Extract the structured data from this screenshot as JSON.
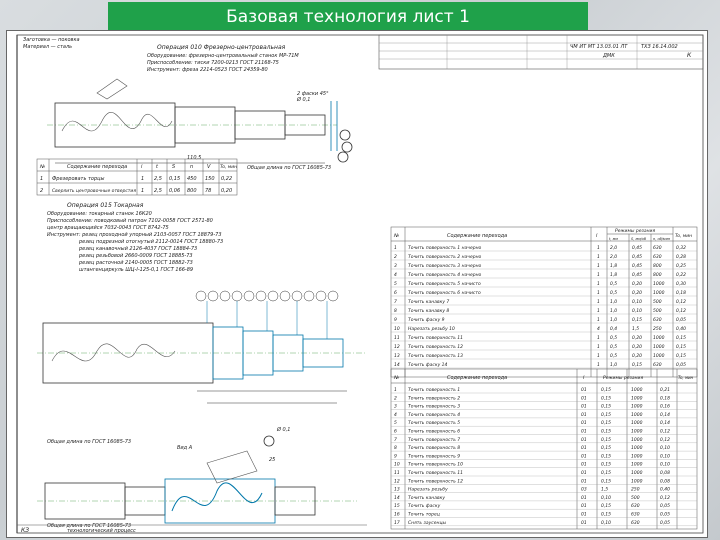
{
  "header": {
    "title": "Базовая технология лист 1"
  },
  "stamp": {
    "code_left": "ЧМ ИТ МТ 13.03.01 ЛТ",
    "code_right": "ТХЗ 16.14.002",
    "sheet_mark": "ДМК",
    "sheet_letter": "К"
  },
  "operation_1": {
    "title": "Операция 010 Фрезерно-центровальная",
    "equipment": "Оборудование: фрезерно-центровальный станок МР-71М",
    "tool_holder": "Приспособление: тиски 7200-0213 ГОСТ 21168-75",
    "tool": "Инструмент: фреза 2214-0523 ГОСТ 24359-80",
    "dim_1": "2 фаски 45°",
    "dim_2": "Ø 0,1",
    "dim_3": "110,5",
    "section_note": "Общая длина по ГОСТ 16085-73",
    "table_headers": [
      "№",
      "Содержание перехода",
      "i",
      "t",
      "S",
      "n",
      "V",
      "To, мин"
    ],
    "table_rows": [
      [
        "1",
        "Фрезеровать торцы",
        "1",
        "2,5",
        "0,15",
        "450",
        "150",
        "0,22"
      ],
      [
        "2",
        "Сверлить центровочные отверстия",
        "1",
        "2,5",
        "0,06",
        "800",
        "78",
        "0,20"
      ]
    ]
  },
  "operation_2": {
    "title": "Операция 015 Токарная",
    "equipment": "Оборудование: токарный станок 16К20",
    "lines": [
      "Приспособление: поводковый патрон 7102-0058 ГОСТ 2571-80",
      "центр вращающийся 7032-0043 ГОСТ 8742-75",
      "Инструмент: резец проходной упорный 2103-0057 ГОСТ 18879-73",
      "резец подрезной отогнутый 2112-0014 ГОСТ 18880-73",
      "резец канавочный 2126-4037 ГОСТ 18884-73",
      "резец резьбовой 2660-0009 ГОСТ 18885-73",
      "резец расточной 2140-0005 ГОСТ 18882-73",
      "штангенциркуль ШЦ-I-125-0,1 ГОСТ 166-89"
    ],
    "note_bottom": "Общая длина по ГОСТ 16085-73"
  },
  "table_right_1": {
    "headers": [
      "№",
      "Содержание перехода",
      "i",
      "Режимы резания",
      "To, мин"
    ],
    "sub_headers": [
      "t, мм",
      "S, мм/об",
      "n, об/мин"
    ],
    "rows": [
      [
        "1",
        "Точить поверхность 1 начерно",
        "1",
        "2,0",
        "0,45",
        "630",
        "0,32"
      ],
      [
        "2",
        "Точить поверхность 2 начерно",
        "1",
        "2,0",
        "0,45",
        "630",
        "0,28"
      ],
      [
        "3",
        "Точить поверхность 3 начерно",
        "1",
        "1,8",
        "0,45",
        "800",
        "0,25"
      ],
      [
        "4",
        "Точить поверхность 4 начерно",
        "1",
        "1,8",
        "0,45",
        "800",
        "0,22"
      ],
      [
        "5",
        "Точить поверхность 5 начисто",
        "1",
        "0,5",
        "0,20",
        "1000",
        "0,30"
      ],
      [
        "6",
        "Точить поверхность 6 начисто",
        "1",
        "0,5",
        "0,20",
        "1000",
        "0,18"
      ],
      [
        "7",
        "Точить канавку 7",
        "1",
        "1,0",
        "0,10",
        "500",
        "0,12"
      ],
      [
        "8",
        "Точить канавку 8",
        "1",
        "1,0",
        "0,10",
        "500",
        "0,12"
      ],
      [
        "9",
        "Точить фаску 9",
        "1",
        "1,0",
        "0,15",
        "630",
        "0,05"
      ],
      [
        "10",
        "Нарезать резьбу 10",
        "4",
        "0,4",
        "1,5",
        "250",
        "0,40"
      ],
      [
        "11",
        "Точить поверхность 11",
        "1",
        "0,5",
        "0,20",
        "1000",
        "0,15"
      ],
      [
        "12",
        "Точить поверхность 12",
        "1",
        "0,5",
        "0,20",
        "1000",
        "0,15"
      ],
      [
        "13",
        "Точить поверхность 13",
        "1",
        "0,5",
        "0,20",
        "1000",
        "0,15"
      ],
      [
        "14",
        "Точить фаску 14",
        "1",
        "1,0",
        "0,15",
        "630",
        "0,05"
      ]
    ]
  },
  "table_right_2": {
    "headers": [
      "№",
      "Содержание перехода",
      "i",
      "Режимы резания",
      "To, мин"
    ],
    "rows": [
      [
        "1",
        "Точить поверхность 1",
        "01",
        "0,15",
        "1000",
        "0,21"
      ],
      [
        "2",
        "Точить поверхность 2",
        "01",
        "0,15",
        "1000",
        "0,18"
      ],
      [
        "3",
        "Точить поверхность 3",
        "01",
        "0,15",
        "1000",
        "0,16"
      ],
      [
        "4",
        "Точить поверхность 4",
        "01",
        "0,15",
        "1000",
        "0,14"
      ],
      [
        "5",
        "Точить поверхность 5",
        "01",
        "0,15",
        "1000",
        "0,14"
      ],
      [
        "6",
        "Точить поверхность 6",
        "01",
        "0,15",
        "1000",
        "0,12"
      ],
      [
        "7",
        "Точить поверхность 7",
        "01",
        "0,15",
        "1000",
        "0,12"
      ],
      [
        "8",
        "Точить поверхность 8",
        "01",
        "0,15",
        "1000",
        "0,10"
      ],
      [
        "9",
        "Точить поверхность 9",
        "01",
        "0,15",
        "1000",
        "0,10"
      ],
      [
        "10",
        "Точить поверхность 10",
        "01",
        "0,15",
        "1000",
        "0,10"
      ],
      [
        "11",
        "Точить поверхность 11",
        "01",
        "0,15",
        "1000",
        "0,08"
      ],
      [
        "12",
        "Точить поверхность 12",
        "01",
        "0,15",
        "1000",
        "0,08"
      ],
      [
        "13",
        "Нарезать резьбу",
        "03",
        "1,5",
        "250",
        "0,40"
      ],
      [
        "14",
        "Точить канавку",
        "01",
        "0,10",
        "500",
        "0,12"
      ],
      [
        "15",
        "Точить фаску",
        "01",
        "0,15",
        "630",
        "0,05"
      ],
      [
        "16",
        "Точить торец",
        "01",
        "0,15",
        "630",
        "0,05"
      ],
      [
        "17",
        "Снять заусенцы",
        "01",
        "0,10",
        "630",
        "0,05"
      ]
    ]
  },
  "operation_3": {
    "label_a": "Вид А",
    "label_b": "Ø 0,1",
    "dim_1": "25",
    "note": "Общая длина по ГОСТ 16085-73"
  },
  "footer": {
    "sheet_no": "КЗ",
    "caption": "технологический процесс"
  }
}
